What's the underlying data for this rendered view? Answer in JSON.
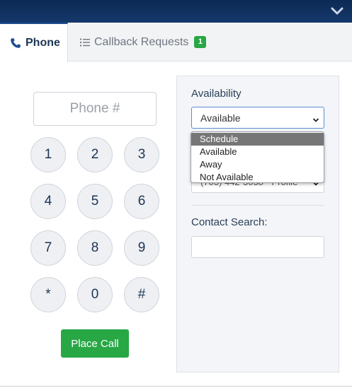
{
  "tabs": {
    "phone_label": "Phone",
    "callback_label": "Callback Requests",
    "callback_count": "1"
  },
  "dialpad": {
    "placeholder": "Phone #",
    "keys": [
      "1",
      "2",
      "3",
      "4",
      "5",
      "6",
      "7",
      "8",
      "9",
      "*",
      "0",
      "#"
    ],
    "place_call_label": "Place Call"
  },
  "availability": {
    "label": "Availability",
    "selected_value": "Available",
    "options": [
      "Schedule",
      "Available",
      "Away",
      "Not Available"
    ],
    "highlighted_option": "Schedule"
  },
  "phone_line": {
    "value": "(703) 442-3038 - Profile"
  },
  "contact_search": {
    "label": "Contact Search:",
    "value": ""
  },
  "icons": {
    "collapse": "chevron-down-icon",
    "phone": "phone-icon",
    "callback": "list-icon"
  },
  "colors": {
    "header": "#14386b",
    "accent_green": "#28a745",
    "dropdown_highlight": "#767676"
  }
}
